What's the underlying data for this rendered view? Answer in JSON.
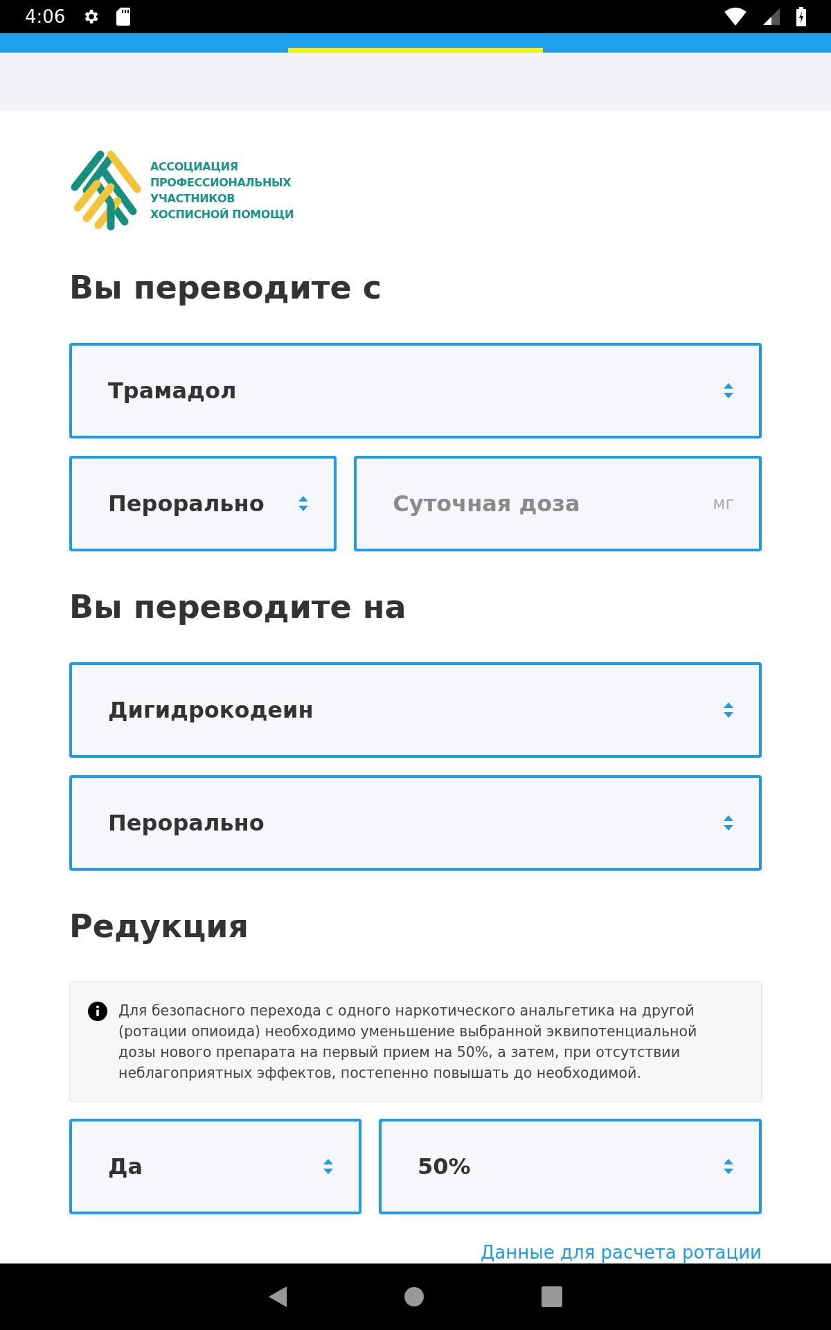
{
  "status_bar": {
    "time": "4:06"
  },
  "logo": {
    "lines": [
      "АССОЦИАЦИЯ",
      "ПРОФЕССИОНАЛЬНЫХ",
      "УЧАСТНИКОВ",
      "ХОСПИСНОЙ ПОМОЩИ"
    ]
  },
  "sections": [
    {
      "title": "Вы переводите с",
      "rows": [
        [
          {
            "kind": "select",
            "value": "Трамадол"
          }
        ],
        [
          {
            "kind": "select",
            "value": "Перорально"
          },
          {
            "kind": "input",
            "placeholder": "Суточная доза",
            "unit": "мг"
          }
        ]
      ]
    },
    {
      "title": "Вы переводите на",
      "rows": [
        [
          {
            "kind": "select",
            "value": "Дигидрокодеин"
          }
        ],
        [
          {
            "kind": "select",
            "value": "Перорально"
          }
        ]
      ]
    },
    {
      "title": "Редукция",
      "note": "Для безопасного перехода с одного наркотического анальгетика на другой (ротации опиоида) необходимо уменьшение выбранной эквипотенциальной дозы нового препарата на первый прием на 50%, а затем, при отсутствии неблагоприятных эффектов, постепенно повышать до необходимой.",
      "rows": [
        [
          {
            "kind": "select",
            "value": "Да"
          },
          {
            "kind": "select",
            "value": "50%"
          }
        ]
      ]
    }
  ],
  "link": "Данные для расчета ротации"
}
